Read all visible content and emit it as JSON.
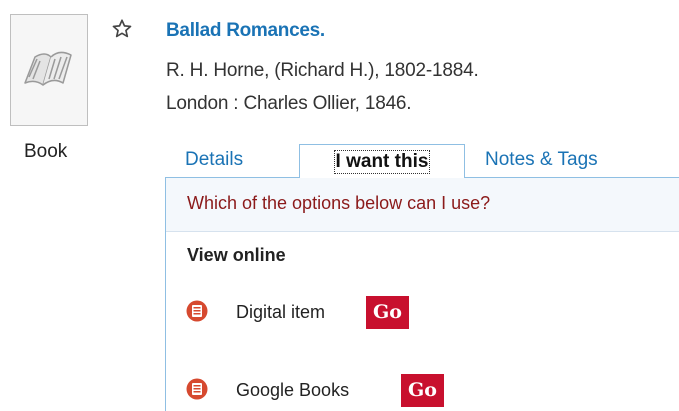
{
  "record": {
    "type_label": "Book",
    "title": "Ballad Romances.",
    "author": "R. H. Horne, (Richard H.), 1802-1884.",
    "publisher": "London : Charles Ollier, 1846."
  },
  "tabs": [
    {
      "label": "Details"
    },
    {
      "label": "I want this"
    },
    {
      "label": "Notes & Tags"
    }
  ],
  "panel": {
    "question": "Which of the options below can I use?",
    "section_heading": "View online",
    "options": [
      {
        "label": "Digital item",
        "button": "Go",
        "icon": "document-icon"
      },
      {
        "label": "Google Books",
        "button": "Go",
        "icon": "document-icon"
      }
    ]
  },
  "colors": {
    "link": "#1a73b5",
    "question_text": "#8b1a1a",
    "go_button": "#c8102e",
    "icon_red": "#d6492f",
    "tab_border": "#8fbfe3"
  }
}
